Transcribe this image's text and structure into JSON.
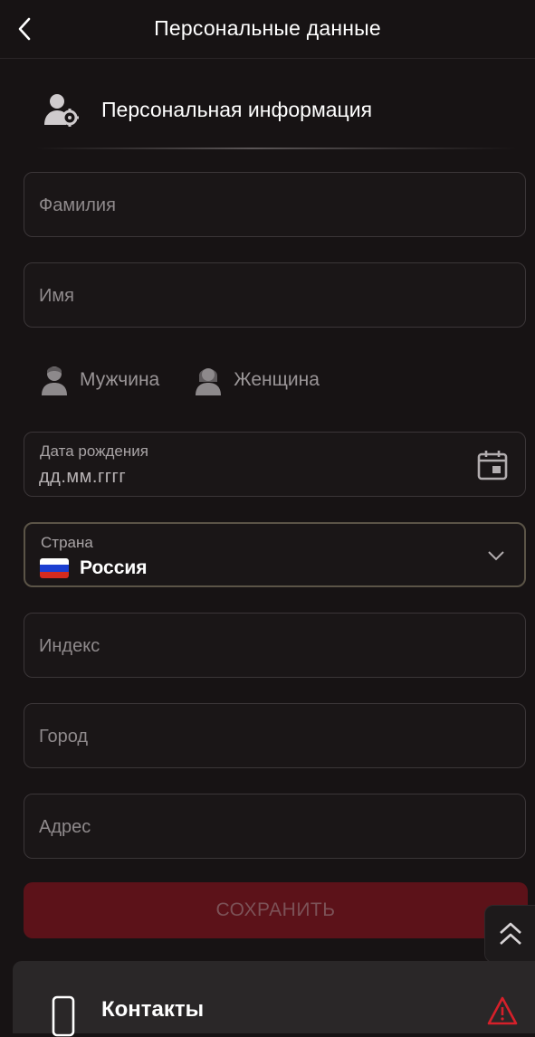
{
  "header": {
    "title": "Персональные данные"
  },
  "section": {
    "title": "Персональная информация"
  },
  "fields": {
    "lastname_placeholder": "Фамилия",
    "firstname_placeholder": "Имя",
    "index_placeholder": "Индекс",
    "city_placeholder": "Город",
    "address_placeholder": "Адрес"
  },
  "gender": {
    "male": "Мужчина",
    "female": "Женщина"
  },
  "birthdate": {
    "label": "Дата рождения",
    "value": "дд.мм.гггг"
  },
  "country": {
    "label": "Страна",
    "value": "Россия",
    "flag_colors": [
      "#ffffff",
      "#1c3fd1",
      "#d52b1e"
    ]
  },
  "save_label": "СОХРАНИТЬ",
  "contacts": {
    "title": "Контакты"
  },
  "colors": {
    "accent_border": "#5b5447",
    "save_bg": "#5c1219",
    "warning": "#d6202a"
  },
  "icons": [
    "back-icon",
    "user-settings-icon",
    "male-icon",
    "female-icon",
    "calendar-icon",
    "chevron-down-icon",
    "scroll-top-icon",
    "phone-icon",
    "warning-icon"
  ]
}
